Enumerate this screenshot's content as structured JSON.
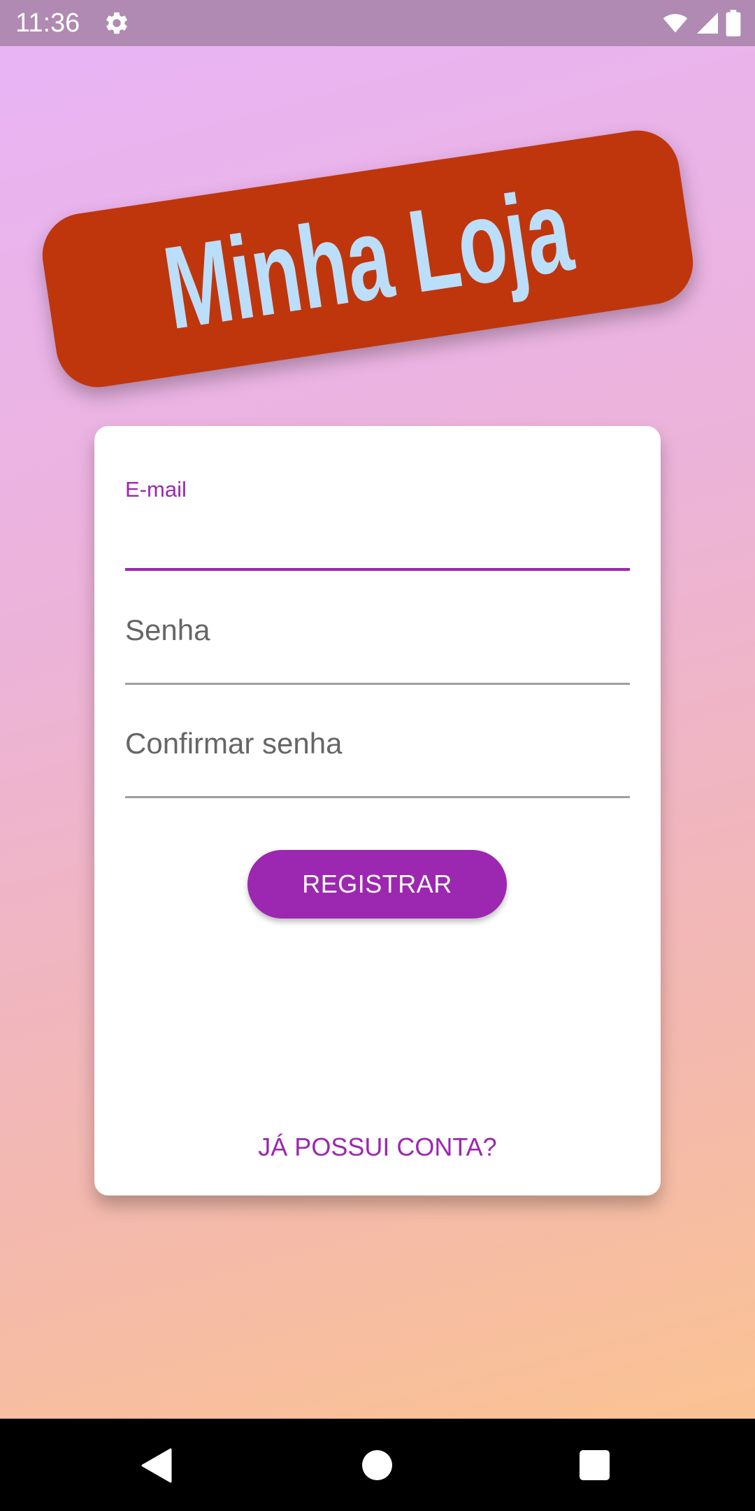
{
  "status_bar": {
    "time": "11:36",
    "icons": [
      "settings-icon",
      "wifi-icon",
      "signal-icon",
      "battery-icon"
    ]
  },
  "logo": {
    "text": "Minha Loja"
  },
  "form": {
    "email_label": "E-mail",
    "password_placeholder": "Senha",
    "confirm_password_placeholder": "Confirmar senha",
    "register_label": "REGISTRAR",
    "login_link_label": "JÁ POSSUI CONTA?"
  },
  "nav_bar": {
    "buttons": [
      "back",
      "home",
      "recents"
    ]
  },
  "colors": {
    "accent": "#9c27b0",
    "banner": "#bf360c",
    "banner_text": "#bbdefb",
    "status_bar": "#b08ab3"
  }
}
